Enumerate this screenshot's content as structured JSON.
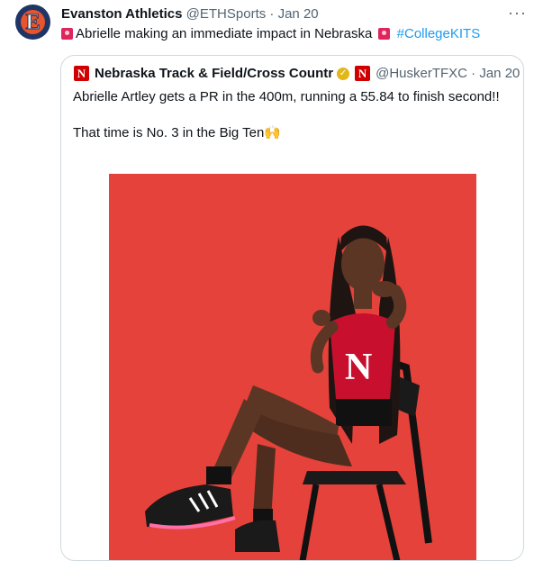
{
  "tweet": {
    "author_name": "Evanston Athletics",
    "handle": "@ETHSports",
    "date": "Jan 20",
    "text": "Abrielle making an immediate impact in Nebraska",
    "hashtag": "#CollegeKITS",
    "more_label": "···",
    "avatar_letter": "E"
  },
  "quoted": {
    "logo_letter": "N",
    "author_name": "Nebraska Track & Field/Cross Countr",
    "handle": "@HuskerTFXC",
    "date": "Jan 20",
    "line1": "Abrielle Artley gets a PR in the 400m, running a 55.84 to finish second!!",
    "line2": "That time is No. 3 in the Big Ten🙌",
    "photo_alt": "Athlete seated on a folding chair against a red backdrop, pointing at the camera",
    "jersey_letter": "N"
  },
  "colors": {
    "brand_orange": "#e8542b",
    "navy": "#1f3566",
    "link_blue": "#1d9bf0",
    "nebraska_red": "#d00000",
    "backdrop_red": "#e23b35"
  }
}
